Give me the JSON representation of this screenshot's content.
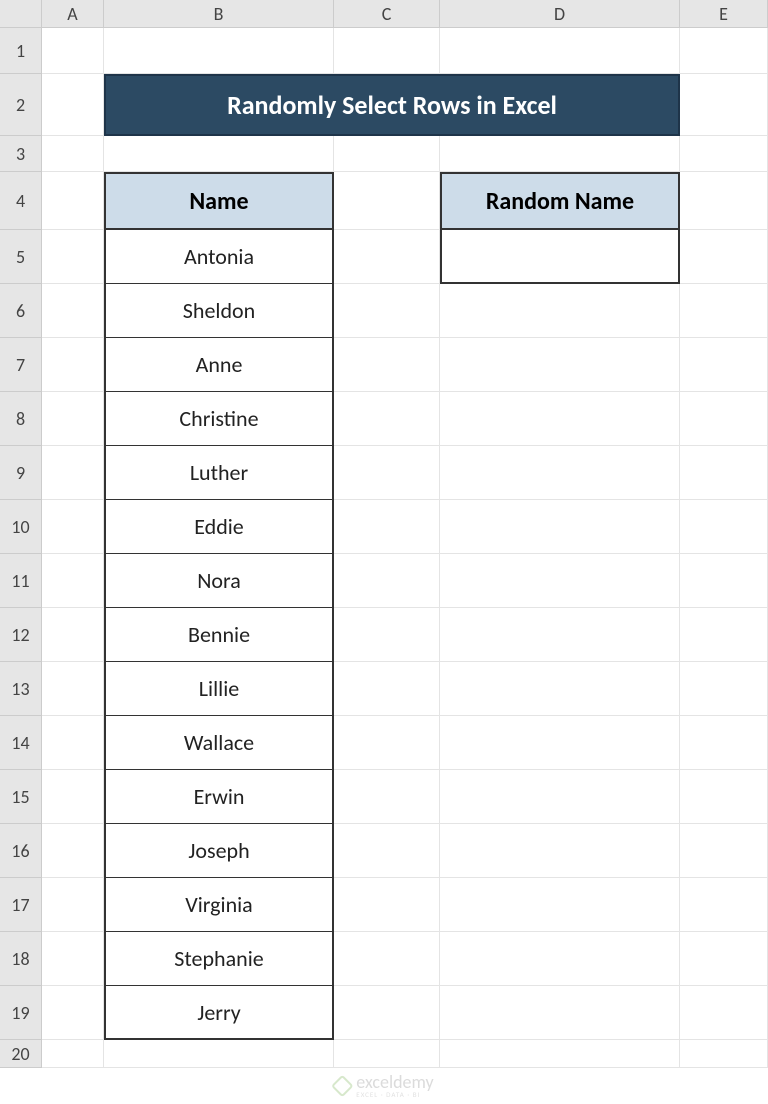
{
  "columns": [
    "A",
    "B",
    "C",
    "D",
    "E"
  ],
  "rows": [
    "1",
    "2",
    "3",
    "4",
    "5",
    "6",
    "7",
    "8",
    "9",
    "10",
    "11",
    "12",
    "13",
    "14",
    "15",
    "16",
    "17",
    "18",
    "19",
    "20"
  ],
  "title": "Randomly Select Rows in Excel",
  "name_header": "Name",
  "random_header": "Random Name",
  "names": [
    "Antonia",
    "Sheldon",
    "Anne",
    "Christine",
    "Luther",
    "Eddie",
    "Nora",
    "Bennie",
    "Lillie",
    "Wallace",
    "Erwin",
    "Joseph",
    "Virginia",
    "Stephanie",
    "Jerry"
  ],
  "random_value": "",
  "watermark": {
    "main": "exceldemy",
    "sub": "EXCEL · DATA · BI"
  }
}
